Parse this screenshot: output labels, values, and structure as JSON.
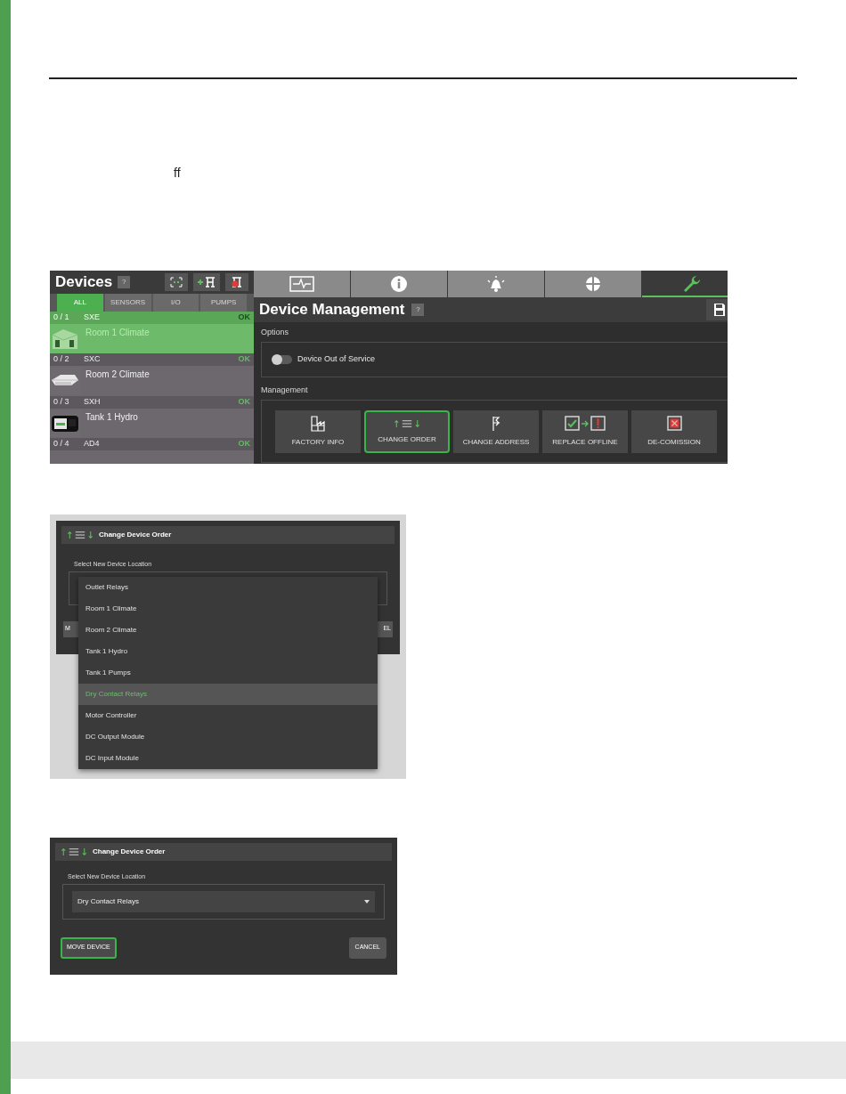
{
  "page_note": "ff",
  "device_screen": {
    "title": "Devices",
    "help": "?",
    "tabs": [
      {
        "selected": false
      },
      {
        "selected": false
      },
      {
        "selected": false
      },
      {
        "selected": false
      },
      {
        "selected": true
      }
    ],
    "filters": [
      {
        "label": "ALL",
        "selected": true
      },
      {
        "label": "SENSORS",
        "selected": false
      },
      {
        "label": "I/O",
        "selected": false
      },
      {
        "label": "PUMPS",
        "selected": false
      }
    ],
    "devices": [
      {
        "index": "0 / 1",
        "code": "SXE",
        "status": "OK",
        "name": "Room 1 Climate",
        "selected": true
      },
      {
        "index": "0 / 2",
        "code": "SXC",
        "status": "OK",
        "name": "Room 2 Climate",
        "selected": false
      },
      {
        "index": "0 / 3",
        "code": "SXH",
        "status": "OK",
        "name": "Tank 1 Hydro",
        "selected": false
      },
      {
        "index": "0 / 4",
        "code": "AD4",
        "status": "OK",
        "selected": false
      }
    ],
    "panel": {
      "title": "Device Management",
      "help": "?",
      "options_label": "Options",
      "toggle": {
        "label": "Device Out of Service",
        "on": false
      },
      "management_label": "Management",
      "actions": [
        {
          "label": "FACTORY INFO",
          "highlighted": false
        },
        {
          "label": "CHANGE ORDER",
          "highlighted": true
        },
        {
          "label": "CHANGE ADDRESS",
          "highlighted": false
        },
        {
          "label": "REPLACE OFFLINE",
          "highlighted": false
        },
        {
          "label": "DE-COMISSION",
          "highlighted": false
        }
      ]
    }
  },
  "dropdown_dialog": {
    "title": "Change Device Order",
    "field_label": "Select New Device Location",
    "buttons": [
      "M",
      "EL"
    ],
    "options": [
      {
        "label": "Outlet Relays",
        "selected": false
      },
      {
        "label": "Room 1 Climate",
        "selected": false
      },
      {
        "label": "Room 2 Climate",
        "selected": false
      },
      {
        "label": "Tank 1 Hydro",
        "selected": false
      },
      {
        "label": "Tank 1 Pumps",
        "selected": false
      },
      {
        "label": "Dry Contact Relays",
        "selected": true
      },
      {
        "label": "Motor Controller",
        "selected": false
      },
      {
        "label": "DC Output Module",
        "selected": false
      },
      {
        "label": "DC Input Module",
        "selected": false
      }
    ]
  },
  "final_dialog": {
    "title": "Change Device Order",
    "field_label": "Select New Device Location",
    "value": "Dry Contact Relays",
    "buttons": [
      {
        "label": "MOVE DEVICE",
        "highlighted": true
      },
      {
        "label": "CANCEL",
        "highlighted": false
      }
    ]
  }
}
